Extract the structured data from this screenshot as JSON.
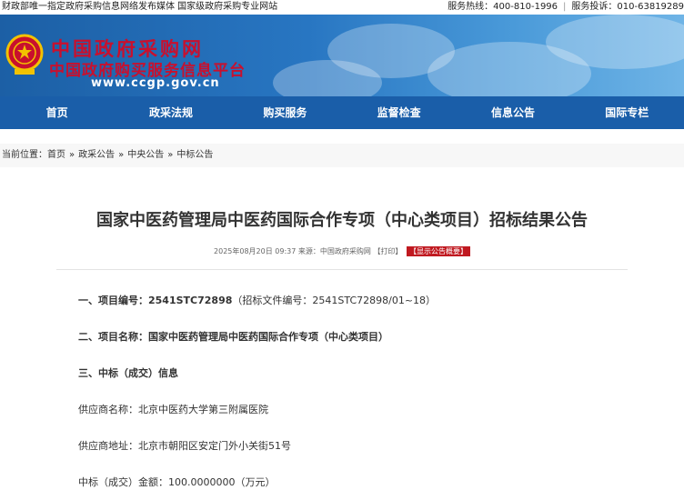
{
  "topbar": {
    "left_text": "财政部唯一指定政府采购信息网络发布媒体 国家级政府采购专业网站",
    "hotline": "服务热线：400-810-1996",
    "complaint": "服务投诉：010-63819289"
  },
  "banner": {
    "title": "中国政府采购网",
    "subtitle": "中国政府购买服务信息平台",
    "url": "www.ccgp.gov.cn"
  },
  "nav": [
    "首页",
    "政采法规",
    "购买服务",
    "监督检查",
    "信息公告",
    "国际专栏"
  ],
  "breadcrumb": {
    "label": "当前位置：",
    "items": [
      "首页",
      "政采公告",
      "中央公告",
      "中标公告"
    ]
  },
  "article": {
    "title": "国家中医药管理局中医药国际合作专项（中心类项目）招标结果公告",
    "meta_date": "2025年08月20日 09:37",
    "meta_source": "来源：中国政府采购网",
    "meta_print": "【打印】",
    "meta_badge": "【显示公告概要】",
    "s1_label": "一、项目编号：",
    "s1_value": "2541STC72898",
    "s1_extra": "（招标文件编号：2541STC72898/01~18）",
    "s2_label": "二、项目名称：",
    "s2_value": "国家中医药管理局中医药国际合作专项（中心类项目）",
    "s3_label": "三、中标（成交）信息",
    "supplier_name_label": "供应商名称：",
    "supplier_name": "北京中医药大学第三附属医院",
    "supplier_addr_label": "供应商地址：",
    "supplier_addr": "北京市朝阳区安定门外小关街51号",
    "amount_label": "中标（成交）金额：",
    "amount": "100.0000000（万元）"
  },
  "colors": {
    "nav_bg": "#1a5ea9",
    "title_red": "#c8102e",
    "badge_red": "#c01920"
  }
}
